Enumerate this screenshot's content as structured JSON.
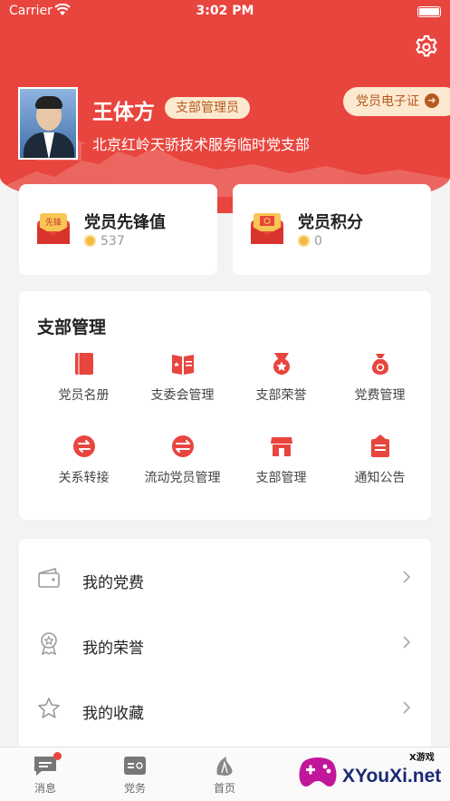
{
  "status_bar": {
    "carrier": "Carrier",
    "time": "3:02 PM"
  },
  "profile": {
    "name": "王体方",
    "role": "支部管理员",
    "organization": "北京红岭天骄技术服务临时党支部",
    "ecard_label": "党员电子证"
  },
  "stats": [
    {
      "title": "党员先锋值",
      "value": "537",
      "icon": "vanguard-envelope-icon"
    },
    {
      "title": "党员积分",
      "value": "0",
      "icon": "party-points-icon"
    }
  ],
  "management": {
    "title": "支部管理",
    "items": [
      {
        "label": "党员名册",
        "icon": "book-icon"
      },
      {
        "label": "支委会管理",
        "icon": "committee-book-icon"
      },
      {
        "label": "支部荣誉",
        "icon": "medal-icon"
      },
      {
        "label": "党费管理",
        "icon": "money-bag-icon"
      },
      {
        "label": "关系转接",
        "icon": "transfer-icon"
      },
      {
        "label": "流动党员管理",
        "icon": "mobile-member-icon"
      },
      {
        "label": "支部管理",
        "icon": "store-icon"
      },
      {
        "label": "通知公告",
        "icon": "clipboard-icon"
      }
    ]
  },
  "menu": [
    {
      "label": "我的党费",
      "icon": "wallet-icon"
    },
    {
      "label": "我的荣誉",
      "icon": "award-icon"
    },
    {
      "label": "我的收藏",
      "icon": "star-icon"
    }
  ],
  "tabbar": [
    {
      "label": "消息",
      "icon": "message-icon",
      "badge": true
    },
    {
      "label": "党务",
      "icon": "party-affairs-icon",
      "badge": false
    },
    {
      "label": "首页",
      "icon": "home-emblem-icon",
      "badge": false
    }
  ],
  "watermark": {
    "brand": "XYouXi.net",
    "tag": "X游戏"
  },
  "colors": {
    "primary": "#e8453e",
    "badge_bg": "#fde9cf",
    "badge_text": "#b45a22"
  }
}
